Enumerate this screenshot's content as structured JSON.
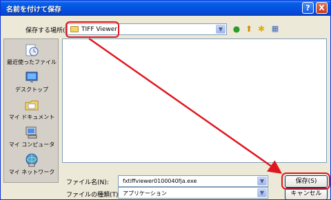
{
  "window": {
    "title": "名前を付けて保存",
    "help_glyph": "?",
    "close_glyph": "X"
  },
  "savein": {
    "label": "保存する場所(I):",
    "value": "TIFF Viewer"
  },
  "toolbar": {
    "back_icon": "back-arrow-icon",
    "up_icon": "up-folder-icon",
    "newfolder_icon": "new-folder-icon",
    "views_icon": "views-menu-icon"
  },
  "places": [
    {
      "label": "最近使ったファイル",
      "icon": "recent-documents-icon"
    },
    {
      "label": "デスクトップ",
      "icon": "desktop-icon"
    },
    {
      "label": "マイ ドキュメント",
      "icon": "my-documents-icon"
    },
    {
      "label": "マイ コンピュータ",
      "icon": "my-computer-icon"
    },
    {
      "label": "マイ ネットワーク",
      "icon": "my-network-icon"
    }
  ],
  "filename": {
    "label": "ファイル名(N):",
    "value": "fxtiffviewer0100040fja.exe"
  },
  "filetype": {
    "label": "ファイルの種類(T):",
    "value": "アプリケーション"
  },
  "buttons": {
    "save": "保存(S)",
    "cancel": "キャンセル"
  },
  "annotation": {
    "color": "#e0161e"
  }
}
